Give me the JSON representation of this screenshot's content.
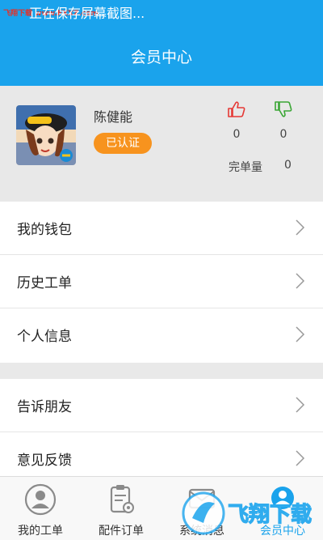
{
  "status_bar": {
    "watermark": "飞翔下载 www.FXXZ.com",
    "text": "正在保存屏幕截图..."
  },
  "header": {
    "title": "会员中心"
  },
  "profile": {
    "name": "陈健能",
    "verified_badge": "已认证",
    "likes": "0",
    "dislikes": "0",
    "orders_label": "完单量",
    "orders_count": "0"
  },
  "menu_group_1": [
    {
      "label": "我的钱包"
    },
    {
      "label": "历史工单"
    },
    {
      "label": "个人信息"
    }
  ],
  "menu_group_2": [
    {
      "label": "告诉朋友"
    },
    {
      "label": "意见反馈"
    }
  ],
  "tabs": [
    {
      "label": "我的工单",
      "icon": "person-icon"
    },
    {
      "label": "配件订单",
      "icon": "clipboard-icon"
    },
    {
      "label": "系统消息",
      "icon": "message-icon"
    },
    {
      "label": "会员中心",
      "icon": "member-icon",
      "active": true
    }
  ],
  "watermark_logo": "飞翔下载",
  "colors": {
    "header_blue": "#1aa3ec",
    "badge_orange": "#f7931e",
    "like_red": "#e53935",
    "dislike_green": "#3aa635"
  }
}
